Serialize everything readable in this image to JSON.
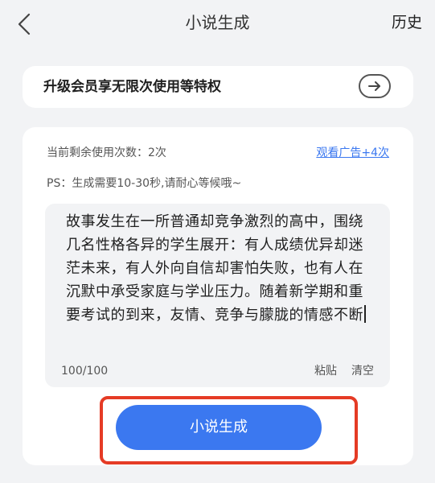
{
  "header": {
    "title": "小说生成",
    "history_label": "历史"
  },
  "vip_banner": {
    "text": "升级会员享无限次使用等特权"
  },
  "card": {
    "remaining_text": "当前剩余使用次数：2次",
    "watch_ad_label": "观看广告+4次",
    "ps_text": "PS：生成需要10-30秒,请耐心等候哦~",
    "story_text": "故事发生在一所普通却竞争激烈的高中，围绕几名性格各异的学生展开：有人成绩优异却迷茫未来，有人外向自信却害怕失败，也有人在沉默中承受家庭与学业压力。随着新学期和重要考试的到来，友情、竞争与朦胧的情感不断",
    "char_count": "100/100",
    "paste_label": "粘贴",
    "clear_label": "清空"
  },
  "generate_button": {
    "label": "小说生成"
  },
  "icons": {
    "back": "chevron-left-icon",
    "vip_arrow": "arrow-right-icon"
  },
  "colors": {
    "accent": "#3b78f0",
    "highlight": "#e53b25",
    "background": "#f2f3f5"
  }
}
